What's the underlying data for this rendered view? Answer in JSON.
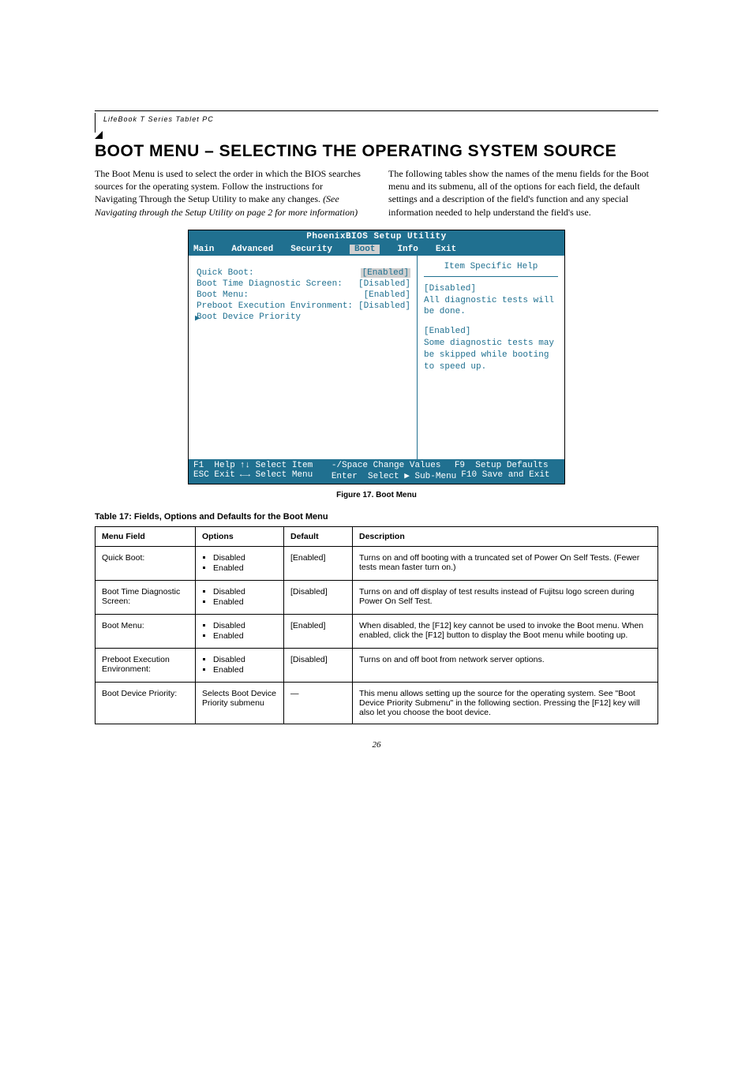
{
  "header": {
    "product_line": "LifeBook T Series Tablet PC"
  },
  "title": "BOOT MENU – SELECTING THE OPERATING SYSTEM SOURCE",
  "intro": {
    "left": "The Boot Menu is used to select the order in which the BIOS searches sources for the operating system. Follow the instructions for Navigating Through the Setup Utility to make any changes. ",
    "left_em": "(See Navigating through the Setup Utility on page 2 for more information)",
    "right": "The following tables show the names of the menu fields for the Boot menu and its submenu, all of the options for each field, the default settings and a description of the field's function and any special information needed to help understand the field's use."
  },
  "bios": {
    "window_title": "PhoenixBIOS Setup Utility",
    "tabs": [
      "Main",
      "Advanced",
      "Security",
      "Boot",
      "Info",
      "Exit"
    ],
    "active_tab": "Boot",
    "rows": [
      {
        "label": "Quick Boot:",
        "value": "[Enabled]",
        "hl": true
      },
      {
        "label": "Boot Time Diagnostic Screen:",
        "value": "[Disabled]"
      },
      {
        "label": "Boot Menu:",
        "value": "[Enabled]"
      },
      {
        "label": "Preboot Execution Environment:",
        "value": "[Disabled]"
      },
      {
        "label": "Boot Device Priority",
        "value": "",
        "caret": true
      }
    ],
    "help": {
      "title": "Item Specific Help",
      "body1": "[Disabled]",
      "body2": "All diagnostic tests will be done.",
      "body3": "[Enabled]",
      "body4": "Some diagnostic tests may be skipped while booting to speed up."
    },
    "footer": {
      "f1": "F1",
      "help": "Help",
      "updown": "↑↓",
      "select_item": "Select Item",
      "minus_space": "-/Space",
      "change_values": "Change Values",
      "f9": "F9",
      "setup_defaults": "Setup Defaults",
      "esc": "ESC",
      "exit": "Exit",
      "lr": "←→",
      "select_menu": "Select Menu",
      "enter": "Enter",
      "select_sub": "Select ▶ Sub-Menu",
      "f10": "F10",
      "save_exit": "Save and Exit"
    }
  },
  "figcap": "Figure 17.   Boot Menu",
  "table_title": "Table 17: Fields, Options and Defaults for the Boot Menu",
  "table": {
    "headers": [
      "Menu Field",
      "Options",
      "Default",
      "Description"
    ],
    "rows": [
      {
        "field": "Quick Boot:",
        "options": [
          "Disabled",
          "Enabled"
        ],
        "default": "[Enabled]",
        "desc": "Turns on and off booting with a truncated set of Power On Self Tests. (Fewer tests mean faster turn on.)"
      },
      {
        "field": "Boot Time Diagnostic Screen:",
        "options": [
          "Disabled",
          "Enabled"
        ],
        "default": "[Disabled]",
        "desc": "Turns on and off display of test results instead of Fujitsu logo screen during Power On Self Test."
      },
      {
        "field": "Boot Menu:",
        "options": [
          "Disabled",
          "Enabled"
        ],
        "default": "[Enabled]",
        "desc": "When disabled, the [F12] key cannot be used to invoke the Boot menu. When enabled, click the [F12] button to display the Boot menu while booting up."
      },
      {
        "field": "Preboot Execution Environment:",
        "options": [
          "Disabled",
          "Enabled"
        ],
        "default": "[Disabled]",
        "desc": "Turns on and off boot from network server options."
      },
      {
        "field": "Boot Device Priority:",
        "options_text": "Selects Boot Device Priority submenu",
        "default": "—",
        "desc": "This menu allows setting up the source for the operating system. See \"Boot Device Priority Submenu\" in the following section. Pressing the [F12] key will also let you choose the boot device."
      }
    ]
  },
  "pagenum": "26"
}
